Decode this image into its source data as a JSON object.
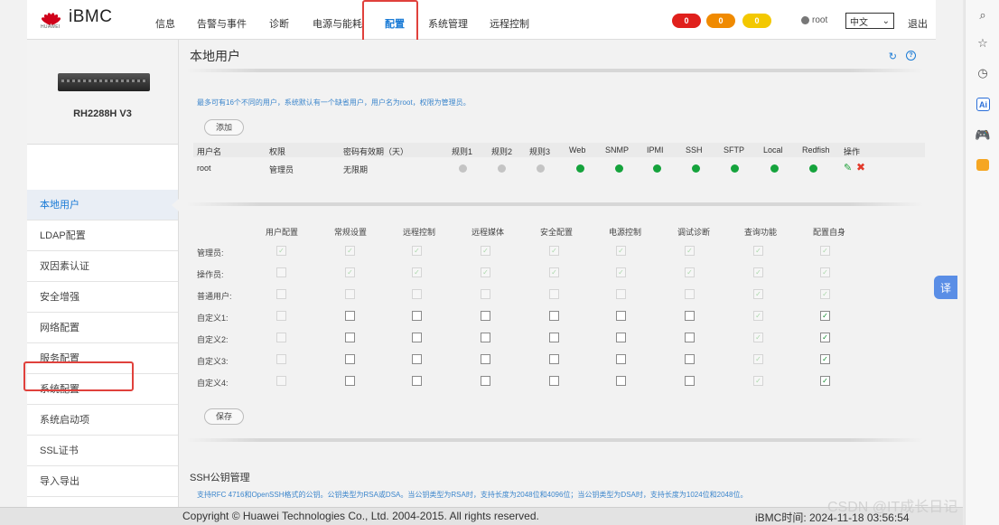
{
  "header": {
    "logo_text": "iBMC",
    "logo_sub": "HUAWEI",
    "nav": [
      "信息",
      "告警与事件",
      "诊断",
      "电源与能耗",
      "配置",
      "系统管理",
      "远程控制"
    ],
    "active_nav": "配置",
    "alarms": [
      {
        "count": "0",
        "color": "#e0201c"
      },
      {
        "count": "0",
        "color": "#f08a00"
      },
      {
        "count": "0",
        "color": "#f3c800"
      }
    ],
    "username": "root",
    "language": "中文",
    "logout": "退出"
  },
  "sidebar": {
    "server_name": "RH2288H V3",
    "items": [
      "本地用户",
      "LDAP配置",
      "双因素认证",
      "安全增强",
      "网络配置",
      "服务配置",
      "系统配置",
      "系统启动项",
      "SSL证书",
      "导入导出"
    ],
    "active_index": 0,
    "highlighted_index": 7
  },
  "main": {
    "title": "本地用户",
    "info": "最多可有16个不同的用户，系统默认有一个缺省用户，用户名为root，权限为管理员。",
    "add_button": "添加",
    "user_table": {
      "headers": [
        "用户名",
        "权限",
        "密码有效期（天）",
        "规则1",
        "规则2",
        "规则3",
        "Web",
        "SNMP",
        "IPMI",
        "SSH",
        "SFTP",
        "Local",
        "Redfish",
        "操作"
      ],
      "rows": [
        {
          "username": "root",
          "role": "管理员",
          "expiry": "无限期",
          "rules": [
            "off",
            "off",
            "off"
          ],
          "services": [
            "on",
            "on",
            "on",
            "on",
            "on",
            "on",
            "on"
          ]
        }
      ]
    },
    "permissions": {
      "columns": [
        "用户配置",
        "常规设置",
        "远程控制",
        "远程媒体",
        "安全配置",
        "电源控制",
        "调试诊断",
        "查询功能",
        "配置自身"
      ],
      "rows": [
        {
          "label": "管理员:",
          "checked": [
            true,
            true,
            true,
            true,
            true,
            true,
            true,
            true,
            true
          ],
          "enabled": [
            false,
            false,
            false,
            false,
            false,
            false,
            false,
            false,
            false
          ]
        },
        {
          "label": "操作员:",
          "checked": [
            false,
            true,
            true,
            true,
            true,
            true,
            true,
            true,
            true
          ],
          "enabled": [
            false,
            false,
            false,
            false,
            false,
            false,
            false,
            false,
            false
          ]
        },
        {
          "label": "普通用户:",
          "checked": [
            false,
            false,
            false,
            false,
            false,
            false,
            false,
            true,
            true
          ],
          "enabled": [
            false,
            false,
            false,
            false,
            false,
            false,
            false,
            false,
            false
          ]
        },
        {
          "label": "自定义1:",
          "checked": [
            false,
            false,
            false,
            false,
            false,
            false,
            false,
            true,
            true
          ],
          "enabled": [
            false,
            true,
            true,
            true,
            true,
            true,
            true,
            false,
            true
          ]
        },
        {
          "label": "自定义2:",
          "checked": [
            false,
            false,
            false,
            false,
            false,
            false,
            false,
            true,
            true
          ],
          "enabled": [
            false,
            true,
            true,
            true,
            true,
            true,
            true,
            false,
            true
          ]
        },
        {
          "label": "自定义3:",
          "checked": [
            false,
            false,
            false,
            false,
            false,
            false,
            false,
            true,
            true
          ],
          "enabled": [
            false,
            true,
            true,
            true,
            true,
            true,
            true,
            false,
            true
          ]
        },
        {
          "label": "自定义4:",
          "checked": [
            false,
            false,
            false,
            false,
            false,
            false,
            false,
            true,
            true
          ],
          "enabled": [
            false,
            true,
            true,
            true,
            true,
            true,
            true,
            false,
            true
          ]
        }
      ]
    },
    "save_button": "保存",
    "ssh_title": "SSH公钥管理",
    "ssh_desc": "支持RFC 4716和OpenSSH格式的公钥。公钥类型为RSA或DSA。当公钥类型为RSA时，支持长度为2048位和4096位；当公钥类型为DSA时，支持长度为1024位和2048位。"
  },
  "footer": {
    "copyright": "Copyright © Huawei Technologies Co., Ltd. 2004-2015. All rights reserved.",
    "bmc_time": "iBMC时间:  2024-11-18 03:56:54"
  },
  "watermark": "CSDN @IT成长日记",
  "browser_toolbar": [
    "search-icon",
    "star-icon",
    "history-icon",
    "ai-icon",
    "game-icon",
    "bag-icon"
  ],
  "translate_button": "译"
}
